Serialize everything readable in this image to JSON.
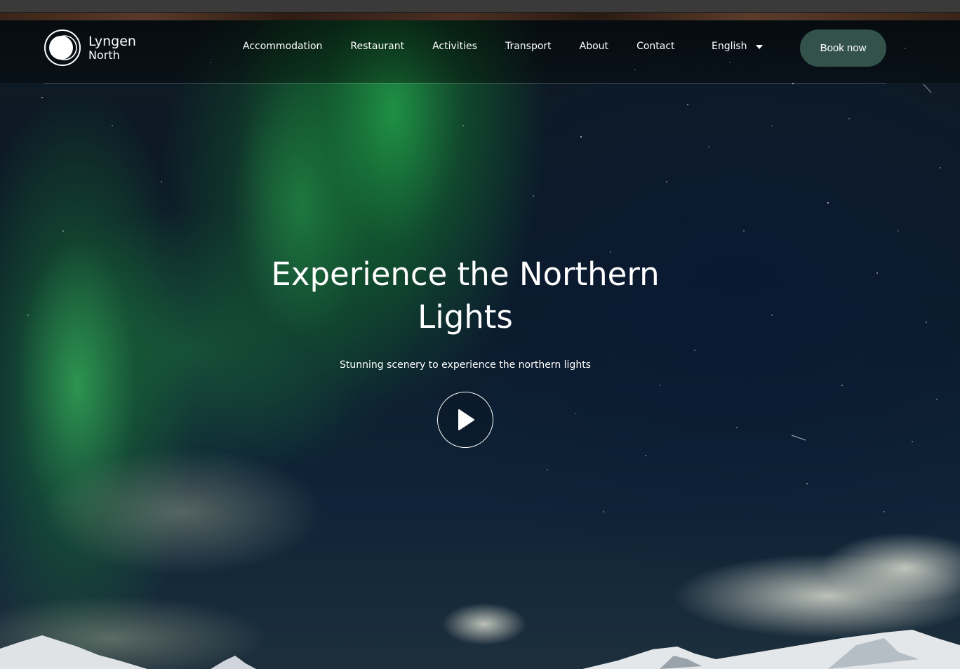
{
  "brand": {
    "name_line1": "Lyngen",
    "name_line2": "North",
    "logo_icon": "double-circle-logo-icon"
  },
  "nav": {
    "items": [
      {
        "label": "Accommodation"
      },
      {
        "label": "Restaurant"
      },
      {
        "label": "Activities"
      },
      {
        "label": "Transport"
      },
      {
        "label": "About"
      },
      {
        "label": "Contact"
      }
    ],
    "language": {
      "selected": "English",
      "icon": "caret-down-icon"
    },
    "cta_label": "Book now"
  },
  "hero": {
    "title": "Experience the Northern Lights",
    "subtitle": "Stunning scenery to experience the northern lights",
    "play_icon": "play-icon"
  },
  "colors": {
    "cta_background": "#33524a",
    "text": "#ffffff",
    "aurora_green": "#1f8a3e",
    "night_sky": "#0c1b2a"
  }
}
